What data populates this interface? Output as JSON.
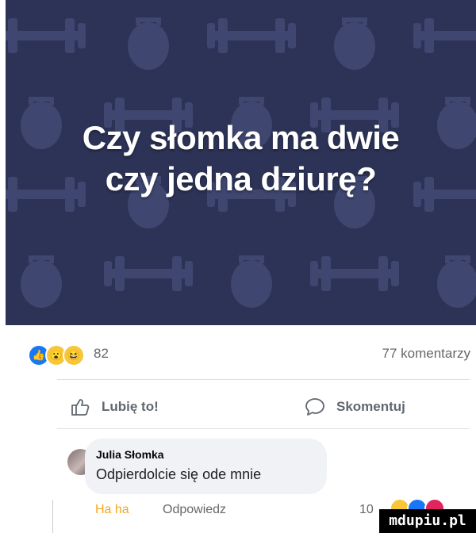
{
  "post": {
    "headline_line1": "Czy słomka ma dwie",
    "headline_line2": "czy jedna dziurę?",
    "banner_bg": "#2d3356",
    "pattern_icons": [
      "dumbbell-icon",
      "kettlebell-icon"
    ]
  },
  "reactions": {
    "icons": [
      "like-icon",
      "wow-icon",
      "haha-icon"
    ],
    "count": "82",
    "comments_count": "77 komentarzy"
  },
  "actions": {
    "like_label": "Lubię to!",
    "comment_label": "Skomentuj"
  },
  "comment": {
    "author": "Julia Słomka",
    "text": "Odpierdolcie się ode mnie",
    "reaction_label": "Ha ha",
    "reply_label": "Odpowiedz",
    "reaction_count": "10"
  },
  "watermark": {
    "text": "mdupiu.pl"
  },
  "colors": {
    "accent": "#1877f2",
    "haha_orange": "#f5a623",
    "muted_text": "#65676b"
  }
}
